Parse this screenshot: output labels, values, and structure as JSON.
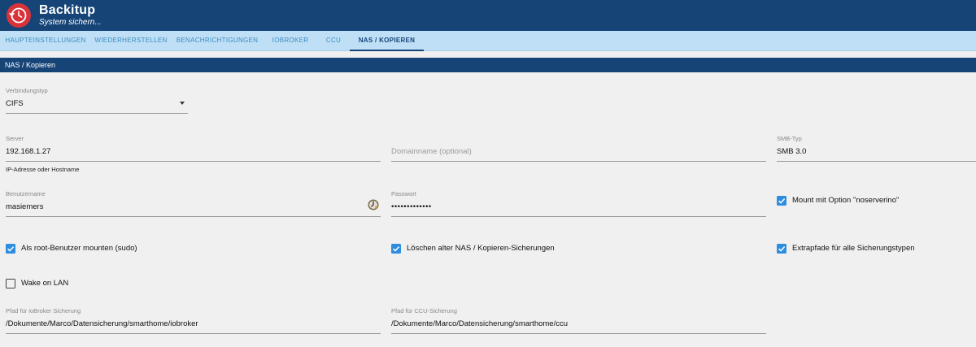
{
  "app": {
    "title": "Backitup",
    "subtitle": "System sichern...",
    "logo_icon": "clock-restore-icon",
    "colors": {
      "header": "#164477",
      "tabbar": "#bedff6",
      "accent": "#2d8ee0",
      "logo": "#d8333a"
    }
  },
  "tabs": [
    {
      "label": "Haupteinstellungen",
      "active": false
    },
    {
      "label": "Wiederherstellen",
      "active": false
    },
    {
      "label": "Benachrichtigungen",
      "active": false
    },
    {
      "label": "ioBroker",
      "active": false
    },
    {
      "label": "CCU",
      "active": false
    },
    {
      "label": "NAS / Kopieren",
      "active": true
    }
  ],
  "section": {
    "title": "NAS / Kopieren"
  },
  "form": {
    "connection_type": {
      "label": "Verbindungstyp",
      "value": "CIFS"
    },
    "server": {
      "label": "Server",
      "value": "192.168.1.27",
      "help": "IP-Adresse oder Hostname"
    },
    "domain": {
      "placeholder": "Domainname (optional)"
    },
    "smb_type": {
      "label": "SMB-Typ",
      "value": "SMB 3.0"
    },
    "username": {
      "label": "Benutzername",
      "value": "masiemers"
    },
    "password": {
      "label": "Passwort",
      "value": "•••••••••••••"
    },
    "ioBroker_path": {
      "label": "Pfad für ioBroker Sicherung",
      "value": "/Dokumente/Marco/Datensicherung/smarthome/iobroker"
    },
    "ccu_path": {
      "label": "Pfad für CCU-Sicherung",
      "value": "/Dokumente/Marco/Datensicherung/smarthome/ccu"
    }
  },
  "checkboxes": {
    "noserverino": {
      "label": "Mount mit Option \"noserverino\"",
      "checked": true
    },
    "sudo": {
      "label": "Als root-Benutzer mounten (sudo)",
      "checked": true
    },
    "delete_old": {
      "label": "Löschen alter NAS / Kopieren-Sicherungen",
      "checked": true
    },
    "extra_paths": {
      "label": "Extrapfade für alle Sicherungstypen",
      "checked": true
    },
    "wake_on_lan": {
      "label": "Wake on LAN",
      "checked": false
    }
  }
}
